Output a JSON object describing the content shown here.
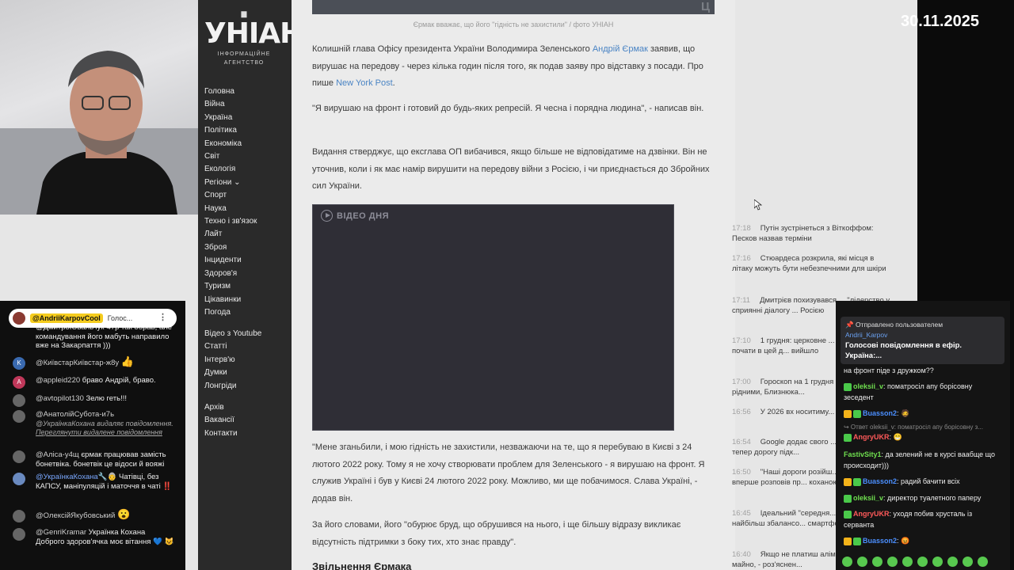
{
  "date": "30.11.2025",
  "logo": {
    "name": "УНІАН",
    "sub1": "ІНФОРМАЦІЙНЕ",
    "sub2": "АГЕНТСТВО"
  },
  "nav": [
    "Головна",
    "Війна",
    "Україна",
    "Політика",
    "Економіка",
    "Світ",
    "Екологія",
    "Регіони ⌄",
    "Спорт",
    "Наука",
    "Техно і зв'язок",
    "Лайт",
    "Зброя",
    "Інциденти",
    "Здоров'я",
    "Туризм",
    "Цікавинки",
    "Погода"
  ],
  "nav2": [
    "Відео з Youtube",
    "Статті",
    "Інтерв'ю",
    "Думки",
    "Лонгріди"
  ],
  "nav3": [
    "Архів",
    "Вакансії",
    "Контакти"
  ],
  "article": {
    "caption": "Єрмак вважає, що його \"гідність не захистили\" / фото УНІАН",
    "p1a": "Колишній глава Офісу президента України Володимира Зеленського ",
    "p1link": "Андрій Єрмак",
    "p1b": " заявив, що вирушає на передову - через кілька годин після того, як подав заяву про відставку з посади. Про пише ",
    "p1link2": "New York Post",
    "p1c": ".",
    "p2": "\"Я вирушаю на фронт і готовий до будь-яких репресій. Я чесна і порядна людина\", - написав він.",
    "p3": "Видання стверджує, що ексглава ОП вибачився, якщо більше не відповідатиме на дзвінки. Він не уточнив, коли і як має намір вирушити на передову війни з Росією, і чи приєднається до Збройних сил України.",
    "video_label": "ВІДЕО ДНЯ",
    "p4": "\"Мене зганьбили, і мою гідність не захистили, незважаючи на те, що я перебуваю в Києві з 24 лютого 2022 року. Тому я не хочу створювати проблем для Зеленського - я вирушаю на фронт. Я служив Україні і був у Києві 24 лютого 2022 року. Можливо, ми ще побачимося. Слава Україні, - додав він.",
    "p5": "За його словами, його \"обурює бруд, що обрушився на нього, і ще більшу відразу викликає відсутність підтримки з боку тих, хто знає правду\".",
    "subhead": "Звільнення Єрмака"
  },
  "feed": [
    {
      "t": "17:18",
      "txt": "Путін зустрінеться з Віткоффом: Песков назвав терміни"
    },
    {
      "t": "17:16",
      "txt": "Стюардеса розкрила, які місця в літаку можуть бути небезпечними для шкіри"
    },
    {
      "t": "17:11",
      "txt": "Дмитрієв похизувався ... \"лідерство у сприянні діалогу ... Росією"
    },
    {
      "t": "17:10",
      "txt": "1 грудня: церковне ... що важливо почати в цей д... вийшло"
    },
    {
      "t": "17:00",
      "txt": "Гороскоп на 1 грудня ... зустріч з рідними, Близнюка..."
    },
    {
      "t": "16:56",
      "txt": "У 2026 вх носитиму..."
    },
    {
      "t": "16:54",
      "txt": "Google додає свого ... в \"Карти\": тепер дорогу підк..."
    },
    {
      "t": "16:50",
      "txt": "\"Наші дороги розійш... Олійник вперше розповів пр... коханою"
    },
    {
      "t": "16:45",
      "txt": "Ідеальний \"середня... обрали 5 найбільш збалансо... смартфонів 2025-го"
    },
    {
      "t": "16:40",
      "txt": "Якщо не платиш алім... відібрати майно, - роз'яснен..."
    }
  ],
  "lchat": {
    "pinned_user": "@AndriiKarpovCool",
    "pinned_text": "Голос...",
    "partial": "@ДмитроЮвальчук-47р так обрав, але командування його мабуть направило вже на Закарпаття )))",
    "msgs": [
      {
        "u": "@КиївстарКиївстар-ж8у",
        "txt": "👍",
        "av": "K"
      },
      {
        "u": "@appleid220",
        "txt": "браво Андрій, браво.",
        "av": "A"
      },
      {
        "u": "@avtopilot130",
        "txt": "Зелю геть!!!",
        "av": ""
      },
      {
        "u": "@АнатолійСубота-и7ь",
        "txt": "@УкраїнкаКохана видаляє повідомлення.",
        "link": "Переглянути видалене повідомлення",
        "av": ""
      },
      {
        "u": "@Аліса-у4щ",
        "txt": "єрмак працював замість бонетвіка. бонетвік це відоси й вояжі",
        "av": ""
      },
      {
        "u": "@УкраїнкаКохана🔧👵",
        "txt": "Чатівці, без КАПСУ, маніпуляцій і маточчя в чаті ‼️",
        "av": ""
      },
      {
        "u": "@ОлексійЯкубовський",
        "txt": "😮",
        "av": ""
      },
      {
        "u": "@GenriKramar",
        "txt": "Українка Кохана Доброго здоров'ячка моє вітання 💙 😺",
        "av": ""
      }
    ]
  },
  "rchat": {
    "pin_by": "📌 Отправлено пользователем",
    "pin_name": "Andrii_Karpov",
    "pin_text": "Голосові повідомлення в ефір. Україна:...",
    "line0": "на фронт піде з дружком??",
    "msgs": [
      {
        "u": "oleksii_v",
        "c": "g",
        "txt": "поматросіл апу борісовну зеседент"
      },
      {
        "u": "Buasson2",
        "c": "b",
        "txt": "🧔"
      },
      {
        "reply": "↪ Ответ oleksii_v: поматросіл апу борісовну з..."
      },
      {
        "u": "AngryUKR",
        "c": "r",
        "txt": "😁"
      },
      {
        "u": "FastivSity1",
        "c": "g",
        "txt": "да зелений не в курсі ваабще що происходит)))"
      },
      {
        "u": "Buasson2",
        "c": "b",
        "txt": "радий бачити всіх"
      },
      {
        "u": "oleksii_v",
        "c": "g",
        "txt": "директор туалетного паперу"
      },
      {
        "u": "AngryUKR",
        "c": "r",
        "txt": "уходя побив хрусталь із серванта"
      },
      {
        "u": "Buasson2",
        "c": "b",
        "txt": "😡"
      }
    ]
  }
}
